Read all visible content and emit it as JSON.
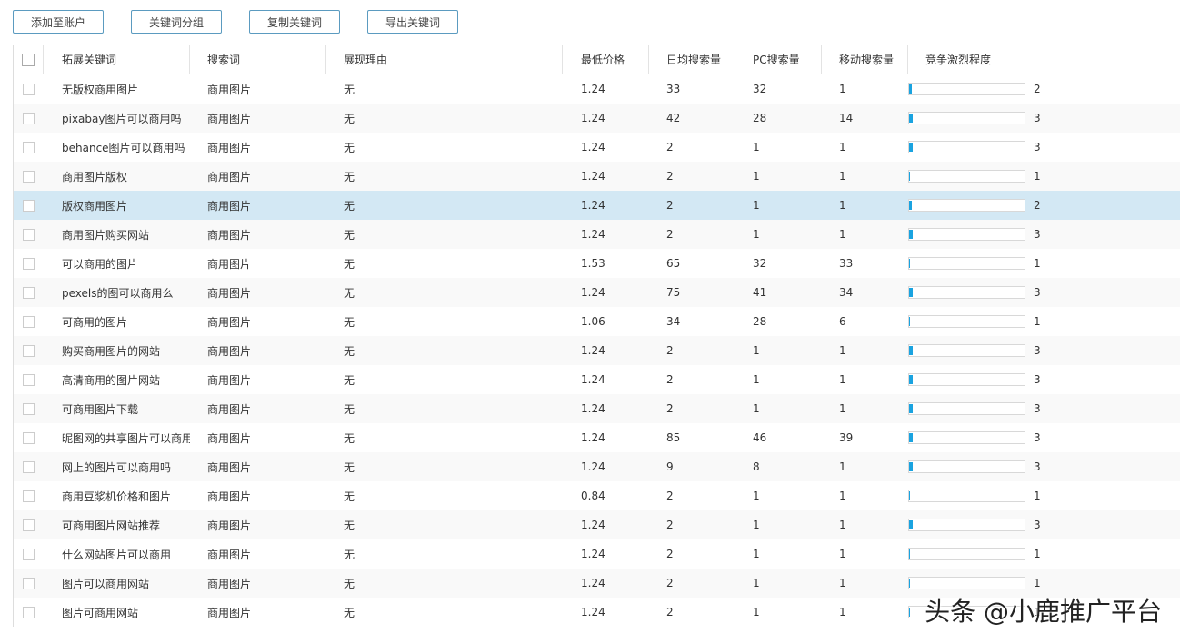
{
  "toolbar": {
    "buttons": [
      "添加至账户",
      "关键词分组",
      "复制关键词",
      "导出关键词"
    ]
  },
  "table": {
    "headers": [
      "拓展关键词",
      "搜索词",
      "展现理由",
      "最低价格",
      "日均搜索量",
      "PC搜索量",
      "移动搜索量",
      "竞争激烈程度"
    ],
    "highlight_color": "#d3e8f4",
    "bar_color": "#1aa3e0",
    "selected_row": 4,
    "rows": [
      [
        "无版权商用图片",
        "商用图片",
        "无",
        "1.24",
        "33",
        "32",
        "1",
        "2"
      ],
      [
        "pixabay图片可以商用吗",
        "商用图片",
        "无",
        "1.24",
        "42",
        "28",
        "14",
        "3"
      ],
      [
        "behance图片可以商用吗",
        "商用图片",
        "无",
        "1.24",
        "2",
        "1",
        "1",
        "3"
      ],
      [
        "商用图片版权",
        "商用图片",
        "无",
        "1.24",
        "2",
        "1",
        "1",
        "1"
      ],
      [
        "版权商用图片",
        "商用图片",
        "无",
        "1.24",
        "2",
        "1",
        "1",
        "2"
      ],
      [
        "商用图片购买网站",
        "商用图片",
        "无",
        "1.24",
        "2",
        "1",
        "1",
        "3"
      ],
      [
        "可以商用的图片",
        "商用图片",
        "无",
        "1.53",
        "65",
        "32",
        "33",
        "1"
      ],
      [
        "pexels的图可以商用么",
        "商用图片",
        "无",
        "1.24",
        "75",
        "41",
        "34",
        "3"
      ],
      [
        "可商用的图片",
        "商用图片",
        "无",
        "1.06",
        "34",
        "28",
        "6",
        "1"
      ],
      [
        "购买商用图片的网站",
        "商用图片",
        "无",
        "1.24",
        "2",
        "1",
        "1",
        "3"
      ],
      [
        "高清商用的图片网站",
        "商用图片",
        "无",
        "1.24",
        "2",
        "1",
        "1",
        "3"
      ],
      [
        "可商用图片下载",
        "商用图片",
        "无",
        "1.24",
        "2",
        "1",
        "1",
        "3"
      ],
      [
        "昵图网的共享图片可以商用",
        "商用图片",
        "无",
        "1.24",
        "85",
        "46",
        "39",
        "3"
      ],
      [
        "网上的图片可以商用吗",
        "商用图片",
        "无",
        "1.24",
        "9",
        "8",
        "1",
        "3"
      ],
      [
        "商用豆浆机价格和图片",
        "商用图片",
        "无",
        "0.84",
        "2",
        "1",
        "1",
        "1"
      ],
      [
        "可商用图片网站推荐",
        "商用图片",
        "无",
        "1.24",
        "2",
        "1",
        "1",
        "3"
      ],
      [
        "什么网站图片可以商用",
        "商用图片",
        "无",
        "1.24",
        "2",
        "1",
        "1",
        "1"
      ],
      [
        "图片可以商用网站",
        "商用图片",
        "无",
        "1.24",
        "2",
        "1",
        "1",
        "1"
      ],
      [
        "图片可商用网站",
        "商用图片",
        "无",
        "1.24",
        "2",
        "1",
        "1",
        "1"
      ]
    ]
  },
  "watermark": "头条 @小鹿推广平台"
}
